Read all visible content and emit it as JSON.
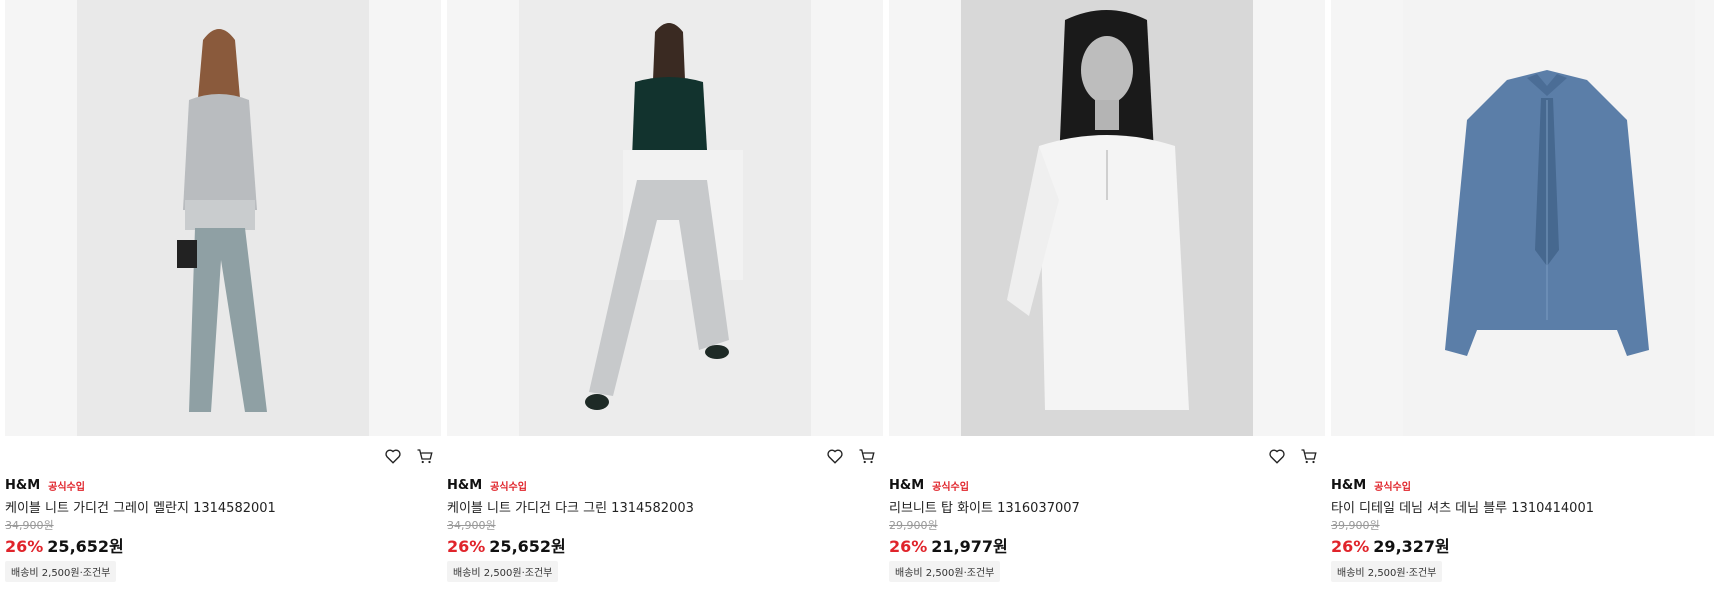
{
  "products": [
    {
      "brand": "H&M",
      "badge": "공식수입",
      "title": "케이블 니트 가디건 그레이 멜란지 1314582001",
      "original_price": "34,900원",
      "discount": "26%",
      "price": "25,652원",
      "shipping": "배송비 2,500원·조건부",
      "icons": [
        "heart-icon",
        "cart-icon"
      ],
      "image_tone": "#e9e9e9"
    },
    {
      "brand": "H&M",
      "badge": "공식수입",
      "title": "케이블 니트 가디건 다크 그린 1314582003",
      "original_price": "34,900원",
      "discount": "26%",
      "price": "25,652원",
      "shipping": "배송비 2,500원·조건부",
      "icons": [
        "heart-icon",
        "cart-icon"
      ],
      "image_tone": "#ececec"
    },
    {
      "brand": "H&M",
      "badge": "공식수입",
      "title": "리브니트 탑 화이트 1316037007",
      "original_price": "29,900원",
      "discount": "26%",
      "price": "21,977원",
      "shipping": "배송비 2,500원·조건부",
      "icons": [
        "heart-icon",
        "cart-icon"
      ],
      "image_tone": "#d8d8d8"
    },
    {
      "brand": "H&M",
      "badge": "공식수입",
      "title": "타이 디테일 데님 셔츠 데님 블루 1310414001",
      "original_price": "39,900원",
      "discount": "26%",
      "price": "29,327원",
      "shipping": "배송비 2,500원·조건부",
      "icons": [],
      "image_tone": "#f3f3f3"
    }
  ]
}
